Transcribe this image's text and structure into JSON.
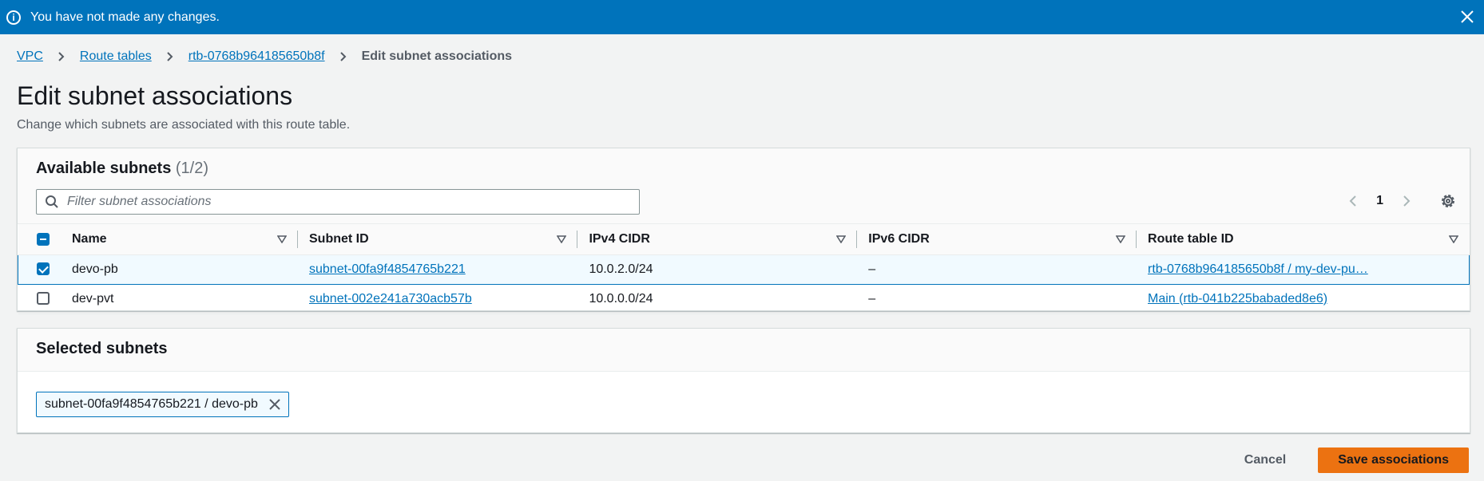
{
  "flash": {
    "message": "You have not made any changes.",
    "icon": "info-icon",
    "color": "#0073bb"
  },
  "breadcrumbs": {
    "items": [
      "VPC",
      "Route tables",
      "rtb-0768b964185650b8f"
    ],
    "current": "Edit subnet associations"
  },
  "page": {
    "title": "Edit subnet associations",
    "description": "Change which subnets are associated with this route table."
  },
  "available": {
    "title": "Available subnets",
    "count": "(1/2)",
    "search_placeholder": "Filter subnet associations",
    "page_number": "1",
    "columns": [
      "Name",
      "Subnet ID",
      "IPv4 CIDR",
      "IPv6 CIDR",
      "Route table ID"
    ],
    "rows": [
      {
        "selected": true,
        "name": "devo-pb",
        "subnet_id": "subnet-00fa9f4854765b221",
        "ipv4": "10.0.2.0/24",
        "ipv6": "–",
        "route_table": "rtb-0768b964185650b8f / my-dev-pu…"
      },
      {
        "selected": false,
        "name": "dev-pvt",
        "subnet_id": "subnet-002e241a730acb57b",
        "ipv4": "10.0.0.0/24",
        "ipv6": "–",
        "route_table": "Main (rtb-041b225babaded8e6)"
      }
    ]
  },
  "selected": {
    "title": "Selected subnets",
    "token": "subnet-00fa9f4854765b221 / devo-pb"
  },
  "actions": {
    "cancel": "Cancel",
    "save": "Save associations",
    "save_color": "#ec7211"
  }
}
